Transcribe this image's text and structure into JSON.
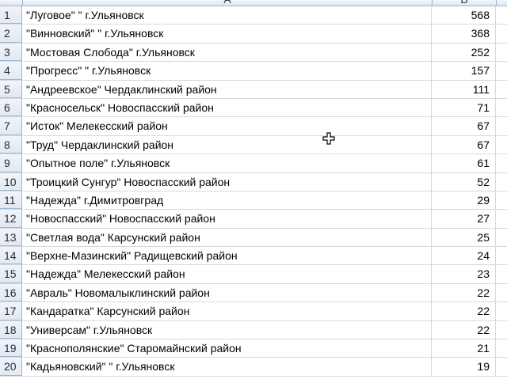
{
  "columns": {
    "a": "A",
    "b": "B"
  },
  "rows": [
    {
      "num": "1",
      "name": "\"Луговое\" \" г.Ульяновск",
      "value": "568"
    },
    {
      "num": "2",
      "name": "\"Винновский\" \" г.Ульяновск",
      "value": "368"
    },
    {
      "num": "3",
      "name": "\"Мостовая Слобода\" г.Ульяновск",
      "value": "252"
    },
    {
      "num": "4",
      "name": "\"Прогресс\" \" г.Ульяновск",
      "value": "157"
    },
    {
      "num": "5",
      "name": "\"Андреевское\" Чердаклинский район",
      "value": "111"
    },
    {
      "num": "6",
      "name": "\"Красносельск\" Новоспасский район",
      "value": "71"
    },
    {
      "num": "7",
      "name": "\"Исток\" Мелекесский район",
      "value": "67"
    },
    {
      "num": "8",
      "name": "\"Труд\" Чердаклинский район",
      "value": "67"
    },
    {
      "num": "9",
      "name": "\"Опытное поле\" г.Ульяновск",
      "value": "61"
    },
    {
      "num": "10",
      "name": "\"Троицкий Сунгур\" Новоспасский район",
      "value": "52"
    },
    {
      "num": "11",
      "name": "\"Надежда\" г.Димитровград",
      "value": "29"
    },
    {
      "num": "12",
      "name": "\"Новоспасский\" Новоспасский район",
      "value": "27"
    },
    {
      "num": "13",
      "name": "\"Светлая вода\" Карсунский район",
      "value": "25"
    },
    {
      "num": "14",
      "name": "\"Верхне-Мазинский\" Радищевский район",
      "value": "24"
    },
    {
      "num": "15",
      "name": "\"Надежда\" Мелекесский район",
      "value": "23"
    },
    {
      "num": "16",
      "name": "\"Авраль\" Новомалыклинский район",
      "value": "22"
    },
    {
      "num": "17",
      "name": "\"Кандаратка\" Карсунский район",
      "value": "22"
    },
    {
      "num": "18",
      "name": "\"Универсам\" г.Ульяновск",
      "value": "22"
    },
    {
      "num": "19",
      "name": "\"Краснополянские\" Старомайнский район",
      "value": "21"
    },
    {
      "num": "20",
      "name": "\"Кадьяновский\" \" г.Ульяновск",
      "value": "19"
    }
  ],
  "icons": {
    "cursor": "cell-select-cross-cursor-icon"
  }
}
